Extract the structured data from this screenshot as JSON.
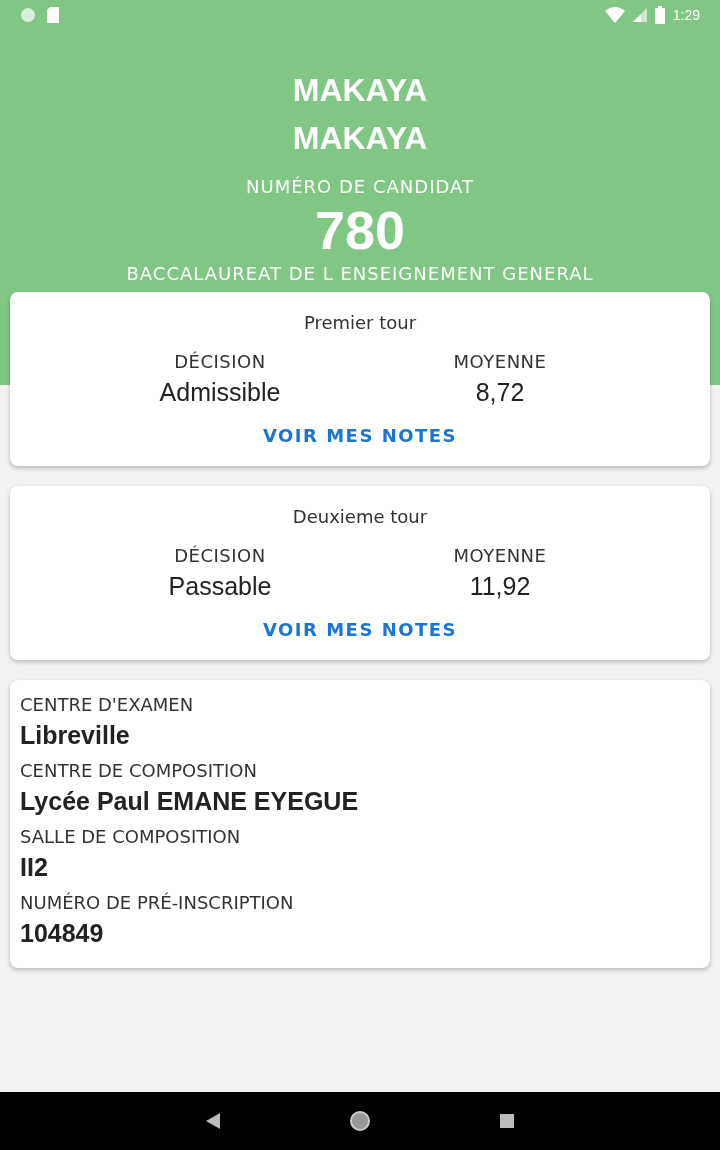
{
  "status_bar": {
    "time": "1:29"
  },
  "header": {
    "name_lines": [
      "MAKAYA",
      "MAKAYA"
    ],
    "candidate_label": "NUMÉRO DE CANDIDAT",
    "candidate_number": "780",
    "exam": "BACCALAUREAT DE L ENSEIGNEMENT GENERAL"
  },
  "rounds": [
    {
      "title": "Premier tour",
      "decision_label": "DÉCISION",
      "decision": "Admissible",
      "average_label": "MOYENNE",
      "average": "8,72",
      "link": "VOIR MES NOTES"
    },
    {
      "title": "Deuxieme tour",
      "decision_label": "DÉCISION",
      "decision": "Passable",
      "average_label": "MOYENNE",
      "average": "11,92",
      "link": "VOIR MES NOTES"
    }
  ],
  "details": [
    {
      "label": "CENTRE D'EXAMEN",
      "value": "Libreville"
    },
    {
      "label": "CENTRE DE COMPOSITION",
      "value": "Lycée Paul EMANE EYEGUE"
    },
    {
      "label": "SALLE DE COMPOSITION",
      "value": "II2"
    },
    {
      "label": "NUMÉRO DE PRÉ-INSCRIPTION",
      "value": "104849"
    }
  ]
}
